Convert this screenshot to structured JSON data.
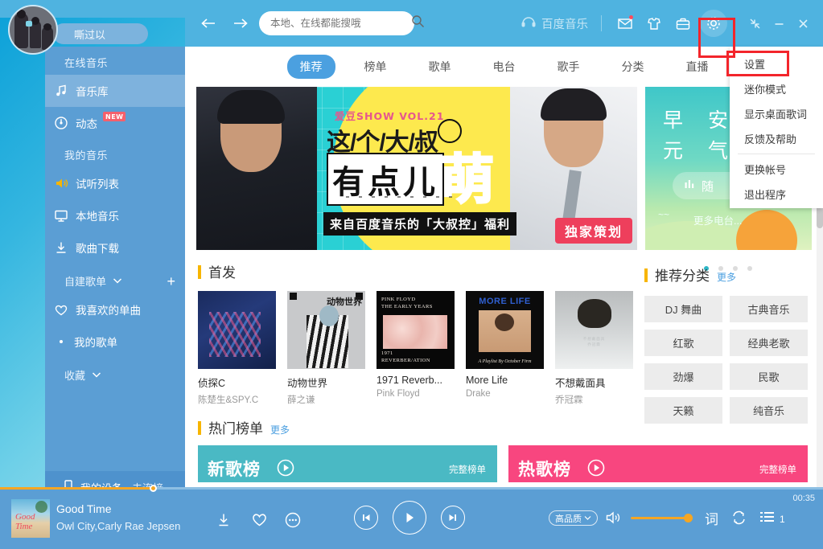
{
  "user": {
    "name": "嘶过以"
  },
  "topbar": {
    "back_icon": "arrow-left-icon",
    "forward_icon": "arrow-right-icon",
    "search_placeholder": "本地、在线都能搜哦",
    "search_value": "",
    "brand": "百度音乐",
    "mail_icon": "mail-icon",
    "gift_icon": "shirt-icon",
    "bag_icon": "briefcase-icon",
    "settings_icon": "gear-icon",
    "collapse_icon": "collapse-icon",
    "minimize_icon": "minimize-icon",
    "close_icon": "close-icon"
  },
  "gear_menu": {
    "items": [
      {
        "label": "设置",
        "highlighted": true
      },
      {
        "label": "迷你模式"
      },
      {
        "label": "显示桌面歌词"
      },
      {
        "label": "反馈及帮助"
      },
      {
        "label": "更换帐号"
      },
      {
        "label": "退出程序"
      }
    ]
  },
  "sidebar": {
    "sections": [
      {
        "title": "在线音乐"
      },
      {
        "title": "我的音乐"
      }
    ],
    "online_items": [
      {
        "label": "音乐库",
        "icon": "music-note-icon",
        "active": true
      },
      {
        "label": "动态",
        "icon": "activity-icon",
        "badge": "NEW"
      }
    ],
    "my_items": [
      {
        "label": "试听列表",
        "icon": "speaker-icon"
      },
      {
        "label": "本地音乐",
        "icon": "monitor-icon"
      },
      {
        "label": "歌曲下载",
        "icon": "download-icon"
      }
    ],
    "playlist_group": {
      "title": "自建歌单",
      "chevron": "chevron-down-icon",
      "add": "plus-icon"
    },
    "playlists": [
      {
        "label": "我喜欢的单曲",
        "icon": "heart-icon"
      },
      {
        "label": "我的歌单",
        "icon": "dot-icon"
      }
    ],
    "favorites_group": {
      "title": "收藏",
      "chevron": "chevron-down-icon"
    },
    "device": {
      "icon": "phone-icon",
      "label": "我的设备",
      "status": "未连接"
    }
  },
  "tabs": [
    {
      "label": "推荐",
      "active": true
    },
    {
      "label": "榜单"
    },
    {
      "label": "歌单"
    },
    {
      "label": "电台"
    },
    {
      "label": "歌手"
    },
    {
      "label": "分类"
    },
    {
      "label": "直播"
    }
  ],
  "banner_main": {
    "vol": "爱豆SHOW VOL.21",
    "line1": "这/个/大/叔",
    "line2": "有点儿",
    "meng": "萌",
    "subtitle": "来自百度音乐的「大叔控」福利",
    "tag": "独家策划"
  },
  "banner_side": {
    "line1": "早 安",
    "line2": "元 气 满",
    "button": "随",
    "button_icon": "bars-icon",
    "more": "更多电台..."
  },
  "first_release": {
    "title": "首发",
    "dots": [
      true,
      false,
      false,
      false
    ],
    "albums": [
      {
        "name": "侦探C",
        "artist": "陈楚生&SPY.C",
        "art": "art1"
      },
      {
        "name": "动物世界",
        "artist": "薛之谦",
        "art": "art2",
        "cover_text": "动物世界"
      },
      {
        "name": "1971 Reverb...",
        "artist": "Pink Floyd",
        "art": "art3",
        "cover_top": "PINK FLOYD\nTHE EARLY YEARS",
        "cover_bottom": "1971\nREVERBER/ATION"
      },
      {
        "name": "More Life",
        "artist": "Drake",
        "art": "art4",
        "cover_text": "MORE LIFE",
        "cover_caption": "A Playlist By October Firm"
      },
      {
        "name": "不想戴面具",
        "artist": "乔冠霖",
        "art": "art5"
      }
    ]
  },
  "categories": {
    "title": "推荐分类",
    "more": "更多",
    "chips": [
      "DJ 舞曲",
      "古典音乐",
      "红歌",
      "经典老歌",
      "劲爆",
      "民歌",
      "天籁",
      "纯音乐"
    ]
  },
  "hot_ranks": {
    "title": "热门榜单",
    "more": "更多",
    "cards": [
      {
        "title": "新歌榜",
        "full": "完整榜单",
        "color": "#4ab9c4",
        "play_icon": "play-circle-icon"
      },
      {
        "title": "热歌榜",
        "full": "完整榜单",
        "color": "#f8467f",
        "play_icon": "play-circle-icon"
      }
    ]
  },
  "player": {
    "title": "Good Time",
    "artist": "Owl City,Carly Rae Jepsen",
    "download_icon": "download-icon",
    "favorite_icon": "heart-icon",
    "more_icon": "more-dots-icon",
    "prev_icon": "previous-icon",
    "play_icon": "play-icon",
    "next_icon": "next-icon",
    "quality": "高品质",
    "quality_chevron": "chevron-down-icon",
    "volume_icon": "volume-icon",
    "lyrics": "词",
    "repeat_icon": "repeat-icon",
    "list_icon": "playlist-icon",
    "list_count": "1",
    "time": "00:35"
  },
  "colors": {
    "accent_blue": "#4fb3e0",
    "sidebar_blue": "#5b9ed4",
    "active_item": "#7eb2dd",
    "orange": "#f5a623",
    "highlight_red": "#f3252b",
    "badge_red": "#f4606c"
  }
}
